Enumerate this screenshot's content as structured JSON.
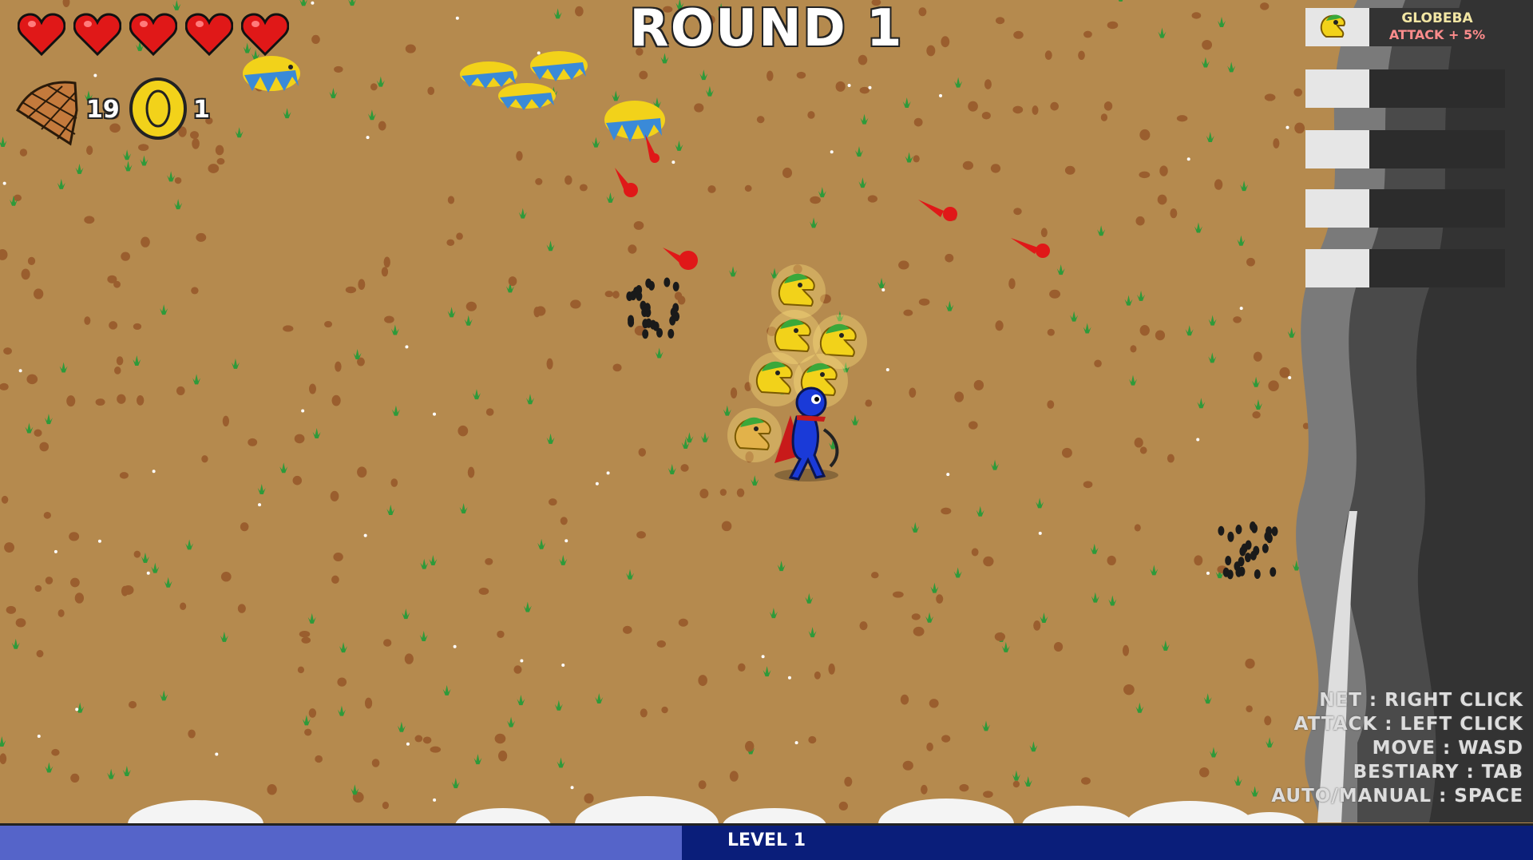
{
  "hud": {
    "round_label": "ROUND 1",
    "hearts": 5,
    "net_count": "19",
    "coin_count": "1",
    "heart_icon": "heart-icon",
    "net_icon": "net-icon",
    "coin_icon": "coin-icon"
  },
  "bestiary": {
    "slots": [
      {
        "name": "GLOBEBA",
        "bonus": "ATTACK + 5%",
        "icon": "globeba-icon"
      },
      {
        "name": "",
        "bonus": ""
      },
      {
        "name": "",
        "bonus": ""
      },
      {
        "name": "",
        "bonus": ""
      },
      {
        "name": "",
        "bonus": ""
      }
    ]
  },
  "controls": [
    "NET : RIGHT CLICK",
    "ATTACK : LEFT CLICK",
    "MOVE : WASD",
    "BESTIARY : TAB",
    "AUTO/MANUAL : SPACE"
  ],
  "xp": {
    "level_label": "LEVEL 1",
    "progress": 0.445
  },
  "colors": {
    "ground": "#b58a4e",
    "heart": "#e01818",
    "coin": "#f2d21a",
    "xp_bar": "#0a1e7a",
    "xp_fill": "#5564c9",
    "bonus_text": "#ff8c8c"
  }
}
